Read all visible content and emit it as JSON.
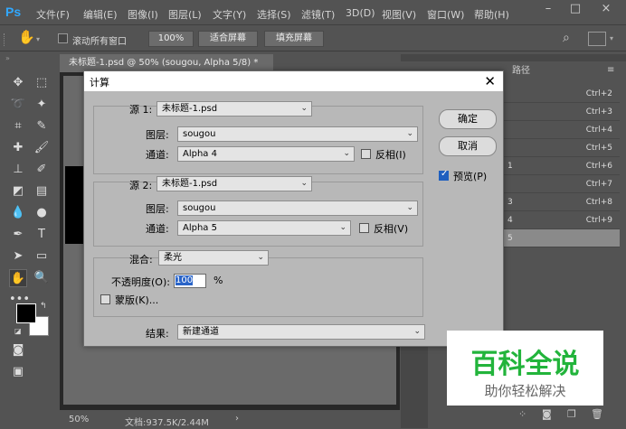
{
  "menubar": {
    "logo": "Ps",
    "items": [
      "文件(F)",
      "编辑(E)",
      "图像(I)",
      "图层(L)",
      "文字(Y)",
      "选择(S)",
      "滤镜(T)",
      "3D(D)",
      "视图(V)",
      "窗口(W)",
      "帮助(H)"
    ],
    "window_controls": [
      "–",
      "□",
      "×"
    ]
  },
  "options": {
    "hand_icon": "hand-icon",
    "scroll_all_label": "滚动所有窗口",
    "zoom_value": "100%",
    "fit_screen": "适合屏幕",
    "fill_screen": "填充屏幕"
  },
  "document": {
    "tab_title": "未标题-1.psd @ 50% (sougou, Alpha 5/8) *",
    "zoom": "50%",
    "doc_size": "文档:937.5K/2.44M"
  },
  "right_panel": {
    "tabs": [
      "路径"
    ],
    "channels": [
      {
        "name": "",
        "shortcut": "Ctrl+2"
      },
      {
        "name": "",
        "shortcut": "Ctrl+3"
      },
      {
        "name": "",
        "shortcut": "Ctrl+4"
      },
      {
        "name": "",
        "shortcut": "Ctrl+5"
      },
      {
        "name": "1",
        "shortcut": "Ctrl+6"
      },
      {
        "name": "",
        "shortcut": "Ctrl+7"
      },
      {
        "name": "3",
        "shortcut": "Ctrl+8"
      },
      {
        "name": "4",
        "shortcut": "Ctrl+9"
      },
      {
        "name": "5",
        "shortcut": ""
      }
    ]
  },
  "dialog": {
    "title": "计算",
    "source1": {
      "label": "源 1:",
      "file": "未标题-1.psd",
      "layer_label": "图层:",
      "layer": "sougou",
      "channel_label": "通道:",
      "channel": "Alpha 4",
      "invert_label": "反相(I)",
      "invert": false
    },
    "source2": {
      "label": "源 2:",
      "file": "未标题-1.psd",
      "layer_label": "图层:",
      "layer": "sougou",
      "channel_label": "通道:",
      "channel": "Alpha 5",
      "invert_label": "反相(V)",
      "invert": false
    },
    "blending": {
      "label": "混合:",
      "mode": "柔光",
      "opacity_label": "不透明度(O):",
      "opacity": "100",
      "percent": "%",
      "mask_label": "蒙版(K)..."
    },
    "result": {
      "label": "结果:",
      "value": "新建通道"
    },
    "ok": "确定",
    "cancel": "取消",
    "preview_label": "预览(P)",
    "preview": true
  },
  "watermark": {
    "line1": "百科全说",
    "line2": "助你轻松解决"
  },
  "colors": {
    "ps_blue": "#31a8ff",
    "watermark_green": "#22b43b"
  }
}
